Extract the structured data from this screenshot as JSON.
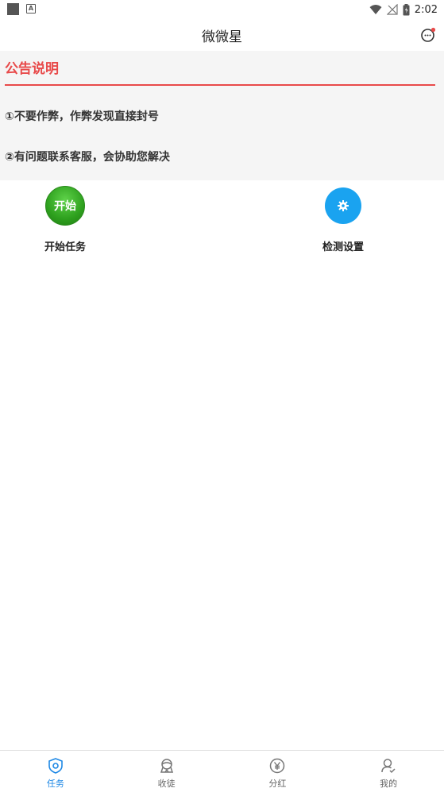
{
  "status_bar": {
    "time": "2:02",
    "icons": [
      "notification-square-icon",
      "a-badge-icon",
      "wifi-icon",
      "no-signal-icon",
      "battery-icon"
    ]
  },
  "header": {
    "title": "微微星",
    "message_icon": "chat-bubble-icon",
    "accent": "#e84a4a"
  },
  "notice": {
    "title": "公告说明",
    "items": [
      "①不要作弊，作弊发现直接封号",
      "②有问题联系客服，会协助您解决"
    ],
    "color": "#e84a4a"
  },
  "actions": {
    "start": {
      "badge": "开始",
      "label": "开始任务",
      "color": "#2ea01e"
    },
    "settings": {
      "label": "检测设置",
      "icon": "gear-icon",
      "color": "#1aa3f0"
    }
  },
  "tabs": [
    {
      "label": "任务",
      "icon": "shield-icon",
      "active": true
    },
    {
      "label": "收徒",
      "icon": "apprentice-icon",
      "active": false
    },
    {
      "label": "分红",
      "icon": "yen-coin-icon",
      "active": false
    },
    {
      "label": "我的",
      "icon": "user-icon",
      "active": false
    }
  ],
  "active_color": "#1e88e5"
}
